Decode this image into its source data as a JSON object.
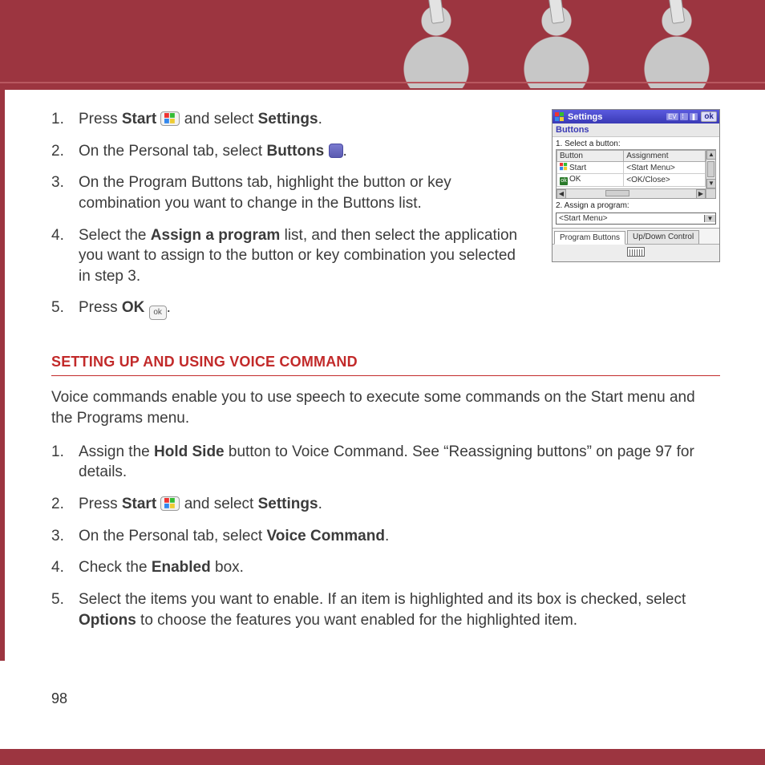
{
  "page_number": "98",
  "steps_section1": [
    {
      "pre": "Press ",
      "bold1": "Start",
      "mid": " ",
      "icon": "win",
      "post": " and select ",
      "bold2": "Settings",
      "tail": "."
    },
    {
      "pre": "On the Personal tab, select ",
      "bold1": "Buttons",
      "mid": " ",
      "icon": "buttons",
      "post": "",
      "bold2": "",
      "tail": "."
    },
    {
      "pre": "On the Program Buttons tab, highlight the button or key combination you want to change in the Buttons list.",
      "bold1": "",
      "mid": "",
      "icon": "",
      "post": "",
      "bold2": "",
      "tail": ""
    },
    {
      "pre": "Select the ",
      "bold1": "Assign a program",
      "mid": " list, and then select the application you want to assign to the button or key combination you selected in step 3.",
      "icon": "",
      "post": "",
      "bold2": "",
      "tail": ""
    },
    {
      "pre": "Press ",
      "bold1": "OK",
      "mid": " ",
      "icon": "ok",
      "post": "",
      "bold2": "",
      "tail": "."
    }
  ],
  "section_heading": "SETTING UP AND USING VOICE COMMAND",
  "intro_paragraph": "Voice commands enable you to use speech to execute some commands on the Start menu and the Programs menu.",
  "steps_section2": [
    {
      "pre": "Assign the ",
      "bold1": "Hold Side",
      "mid": " button to Voice Command. See “Reassigning buttons” on page 97 for details.",
      "icon": "",
      "post": "",
      "bold2": "",
      "tail": ""
    },
    {
      "pre": "Press ",
      "bold1": "Start",
      "mid": " ",
      "icon": "win",
      "post": " and select ",
      "bold2": "Settings",
      "tail": "."
    },
    {
      "pre": "On the Personal tab, select ",
      "bold1": "Voice Command",
      "mid": ".",
      "icon": "",
      "post": "",
      "bold2": "",
      "tail": ""
    },
    {
      "pre": "Check the ",
      "bold1": "Enabled",
      "mid": " box.",
      "icon": "",
      "post": "",
      "bold2": "",
      "tail": ""
    },
    {
      "pre": "Select the items you want to enable. If an item is highlighted and its box is checked, select ",
      "bold1": "Options",
      "mid": " to choose the features you want enabled for the highlighted item.",
      "icon": "",
      "post": "",
      "bold2": "",
      "tail": ""
    }
  ],
  "screenshot": {
    "title": "Settings",
    "ok": "ok",
    "tray": {
      "ev": "EV",
      "sig": "⠇",
      "bat": "❚"
    },
    "subhead": "Buttons",
    "label1": "1. Select a button:",
    "columns": {
      "c1": "Button",
      "c2": "Assignment"
    },
    "rows": [
      {
        "icon": "flag",
        "btn": "Start",
        "assign": "<Start Menu>"
      },
      {
        "icon": "ok",
        "btn": "OK",
        "assign": "<OK/Close>"
      }
    ],
    "label2": "2. Assign a program:",
    "dropdown_value": "<Start Menu>",
    "tabs": {
      "t1": "Program Buttons",
      "t2": "Up/Down Control"
    }
  }
}
